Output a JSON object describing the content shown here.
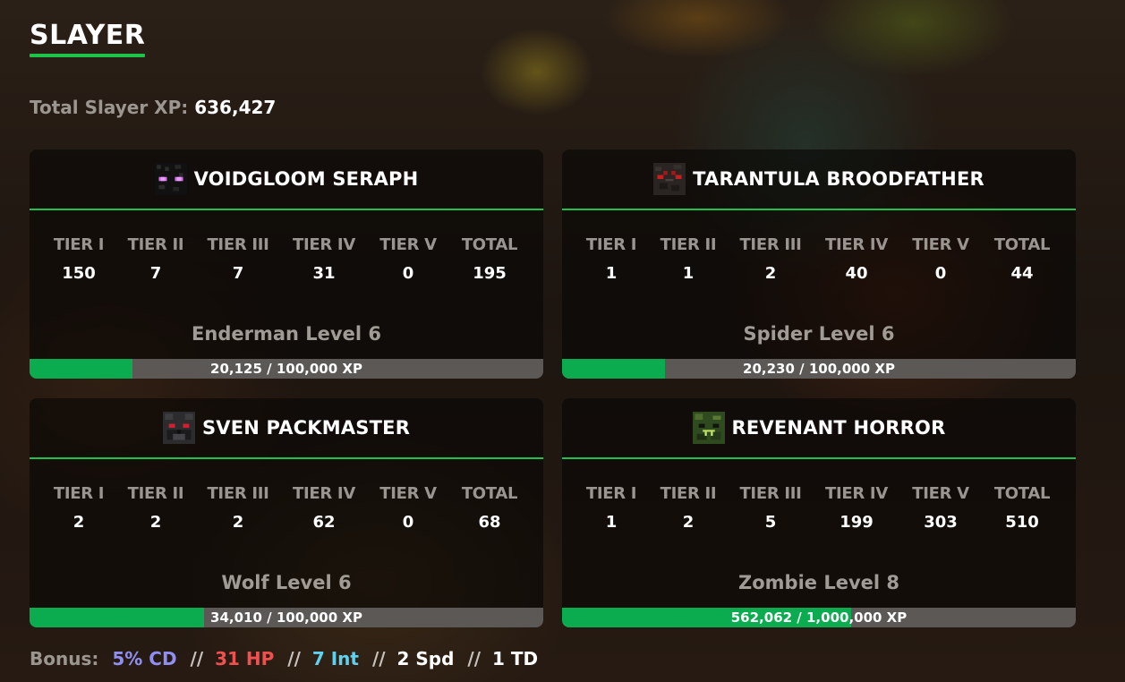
{
  "page": {
    "title": "SLAYER",
    "total_label": "Total Slayer XP:",
    "total_value": "636,427"
  },
  "tier_labels": [
    "TIER I",
    "TIER II",
    "TIER III",
    "TIER IV",
    "TIER V",
    "TOTAL"
  ],
  "slayers": [
    {
      "name": "VOIDGLOOM SERAPH",
      "icon": "enderman-head-icon",
      "tiers": [
        "150",
        "7",
        "7",
        "31",
        "0",
        "195"
      ],
      "level": "Enderman Level 6",
      "xp_text": "20,125 / 100,000 XP",
      "progress": 0.2
    },
    {
      "name": "TARANTULA BROODFATHER",
      "icon": "spider-head-icon",
      "tiers": [
        "1",
        "1",
        "2",
        "40",
        "0",
        "44"
      ],
      "level": "Spider Level 6",
      "xp_text": "20,230 / 100,000 XP",
      "progress": 0.2
    },
    {
      "name": "SVEN PACKMASTER",
      "icon": "wolf-head-icon",
      "tiers": [
        "2",
        "2",
        "2",
        "62",
        "0",
        "68"
      ],
      "level": "Wolf Level 6",
      "xp_text": "34,010 / 100,000 XP",
      "progress": 0.34
    },
    {
      "name": "REVENANT HORROR",
      "icon": "zombie-head-icon",
      "tiers": [
        "1",
        "2",
        "5",
        "199",
        "303",
        "510"
      ],
      "level": "Zombie Level 8",
      "xp_text": "562,062 / 1,000,000 XP",
      "progress": 0.562
    }
  ],
  "bonus": {
    "label": "Bonus:",
    "separator": "//",
    "items": [
      {
        "text": "5% CD",
        "color": "#8f8ff2"
      },
      {
        "text": "31 HP",
        "color": "#f05050"
      },
      {
        "text": "7 Int",
        "color": "#5fd0f0"
      },
      {
        "text": "2 Spd",
        "color": "#ffffff"
      },
      {
        "text": "1 TD",
        "color": "#ffffff"
      }
    ]
  },
  "colors": {
    "accent": "#1ec249",
    "progress_fill": "#0bab4f",
    "progress_track": "#5b5855"
  }
}
